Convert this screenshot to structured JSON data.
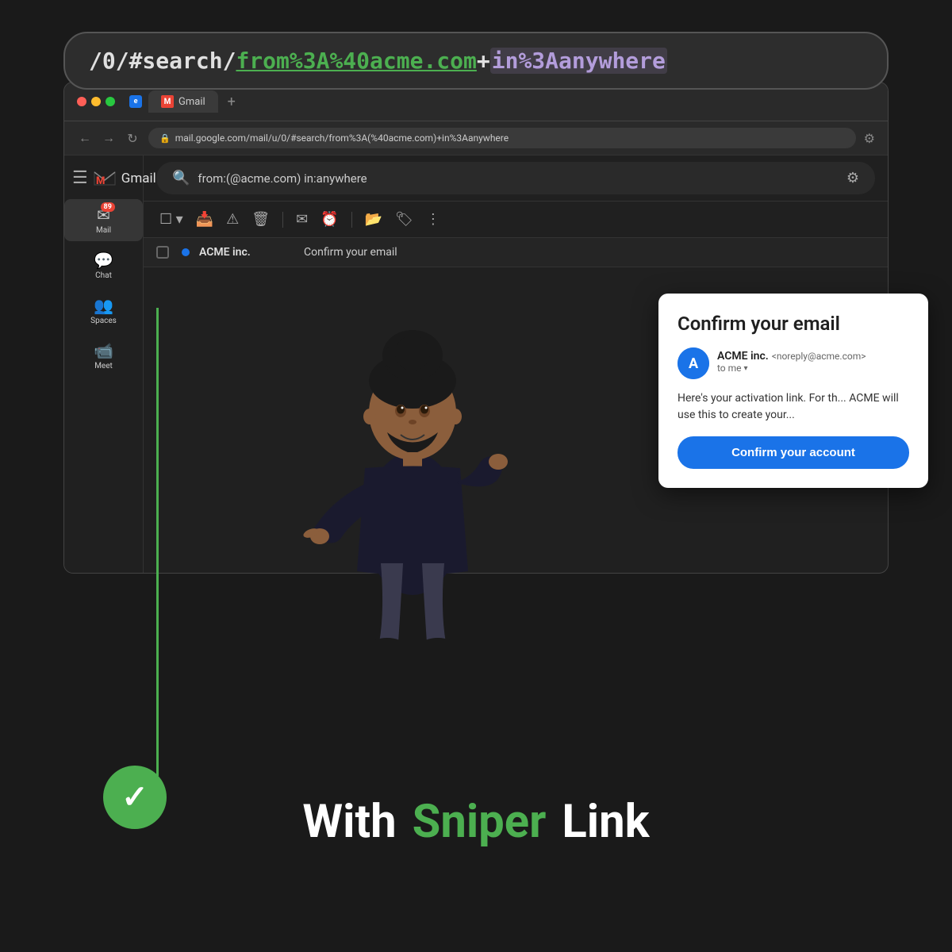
{
  "background": "#1a1a1a",
  "url_bar": {
    "text_normal": "/0/#search/",
    "text_green": "from%3A%40acme.com",
    "text_separator": "+",
    "text_purple": "in%3Aanywhere"
  },
  "browser": {
    "address": "mail.google.com/mail/u/0/#search/from%3A(%40acme.com)+in%3Aanywhere",
    "tab_label": "M",
    "tab_title": "Gmail"
  },
  "gmail": {
    "search_placeholder": "from:(@acme.com) in:anywhere",
    "wordmark": "Gmail",
    "sidebar": {
      "mail_label": "Mail",
      "mail_badge": "89",
      "chat_label": "Chat",
      "spaces_label": "Spaces",
      "meet_label": "Meet"
    },
    "email_row": {
      "sender": "ACME inc.",
      "subject": "Confirm your email"
    },
    "preview": {
      "title": "Confirm your email",
      "sender_name": "ACME inc.",
      "sender_email": "<noreply@acme.com>",
      "to_me": "to me",
      "body": "Here's your activation link. For th... ACME will use this to create your...",
      "button_label": "Confirm your account"
    }
  },
  "bottom": {
    "with_label": "With",
    "sniper_label": "Sniper",
    "link_label": "Link"
  }
}
